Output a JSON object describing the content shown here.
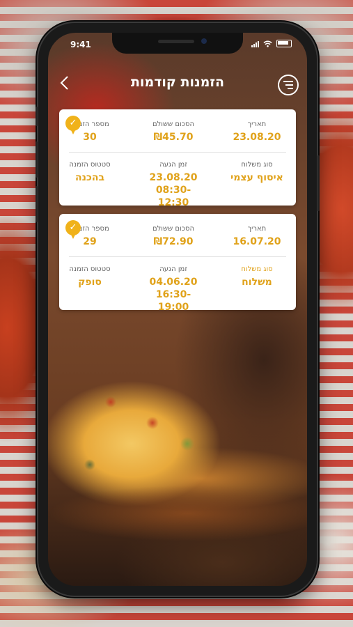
{
  "status_bar": {
    "time": "9:41"
  },
  "header": {
    "title": "הזמנות קודמות",
    "back_icon": "chevron-left-icon",
    "menu_icon": "menu-icon"
  },
  "labels": {
    "date": "תאריך",
    "amount_paid": "הסכום ששולם",
    "order_number": "מספר הזמנה",
    "shipping_type": "סוג משלוח",
    "arrival_time": "זמן הגעה",
    "order_status": "סטטוס הזמנה"
  },
  "orders": [
    {
      "date": "23.08.20",
      "amount": "₪45.70",
      "order_number": "30",
      "shipping_type": "איסוף עצמי",
      "arrival_date": "23.08.20",
      "arrival_window": "08:30-12:30",
      "status": "בהכנה"
    },
    {
      "date": "16.07.20",
      "amount": "₪72.90",
      "order_number": "29",
      "shipping_type": "משלוח",
      "arrival_date": "04.06.20",
      "arrival_window": "16:30-19:00",
      "status": "סופק"
    }
  ],
  "colors": {
    "accent": "#e0a21a",
    "badge": "#f0b21a"
  }
}
